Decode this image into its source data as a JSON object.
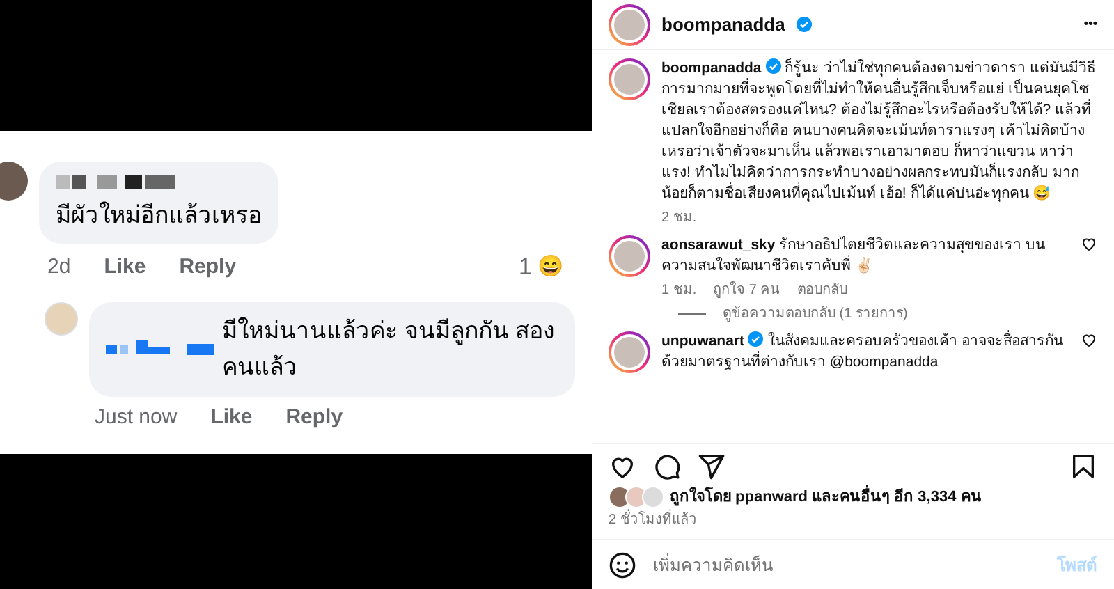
{
  "photo": {
    "comments": [
      {
        "text": "มีผัวใหม่อีกแล้วเหรอ",
        "time": "2d",
        "like": "Like",
        "reply": "Reply",
        "reaction_count": "1",
        "reaction_emoji": "😄"
      },
      {
        "text": "มีใหม่นานแล้วค่ะ จนมีลูกกัน สองคนแล้ว",
        "time": "Just now",
        "like": "Like",
        "reply": "Reply"
      }
    ]
  },
  "post": {
    "username": "boompanadda",
    "more": "•••",
    "caption": {
      "username": "boompanadda",
      "text": "ก็รู้นะ ว่าไม่ใช่ทุกคนต้องตามข่าวดารา แต่มันมีวิธีการมากมายที่จะพูดโดยที่ไม่ทำให้คนอื่นรู้สึกเจ็บหรือแย่ เป็นคนยุคโซเชียลเราต้องสตรองแค่ไหน? ต้องไม่รู้สึกอะไรหรือต้องรับให้ได้? แล้วที่แปลกใจอีกอย่างก็คือ คนบางคนคิดจะเม้นท์ดาราแรงๆ เค้าไม่คิดบ้างเหรอว่าเจ้าตัวจะมาเห็น แล้วพอเราเอามาตอบ ก็หาว่าแขวน หาว่าแรง! ทำไมไม่คิดว่าการกระทำบางอย่างผลกระทบมันก็แรงกลับ มากน้อยก็ตามชื่อเสียงคนที่คุณไปเม้นท์ เฮ้อ! ก็ได้แค่บ่นอ่ะทุกคน 😅",
      "time": "2 ชม."
    },
    "comments": [
      {
        "username": "aonsarawut_sky",
        "verified": false,
        "text": "รักษาอธิปไตยชีวิตและความสุขของเรา บนความสนใจพัฒนาชีวิตเราคับพี่ ✌🏻",
        "time": "1 ชม.",
        "likes": "ถูกใจ 7 คน",
        "reply": "ตอบกลับ",
        "view_replies": "ดูข้อความตอบกลับ (1 รายการ)",
        "liked": false
      },
      {
        "username": "unpuwanart",
        "verified": true,
        "text": "ในสังคมและครอบครัวของเค้า อาจจะสื่อสารกันด้วยมาตรฐานที่ต่างกับเรา @boompanadda",
        "liked": false
      }
    ],
    "liked": false,
    "saved": false,
    "likes_text": "ถูกใจโดย ppanward และคนอื่นๆ อีก 3,334 คน",
    "posted": "2 ชั่วโมงที่แล้ว",
    "comment_box": {
      "placeholder": "เพิ่มความคิดเห็น",
      "post_button": "โพสต์"
    }
  }
}
